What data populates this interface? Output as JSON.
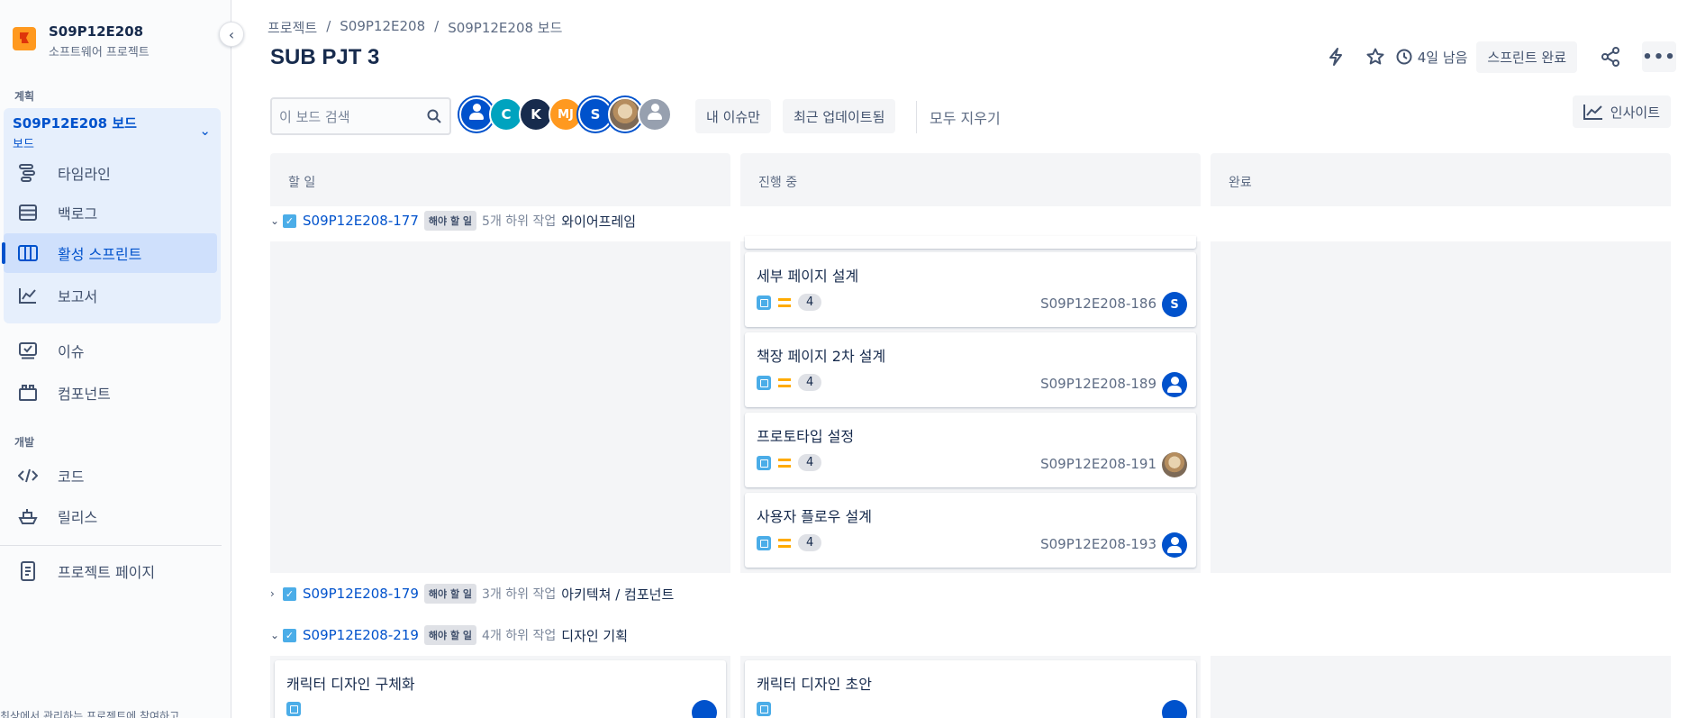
{
  "sidebar": {
    "project_name": "S09P12E208",
    "project_type": "소프트웨어 프로젝트",
    "section_plan": "계획",
    "board_name": "S09P12E208 보드",
    "board_sub": "보드",
    "items": [
      {
        "label": "타임라인",
        "icon": "timeline-icon"
      },
      {
        "label": "백로그",
        "icon": "backlog-icon"
      },
      {
        "label": "활성 스프린트",
        "icon": "board-icon"
      },
      {
        "label": "보고서",
        "icon": "reports-icon"
      }
    ],
    "items_more": [
      {
        "label": "이슈",
        "icon": "issues-icon"
      },
      {
        "label": "컴포넌트",
        "icon": "components-icon"
      }
    ],
    "section_dev": "개발",
    "dev_items": [
      {
        "label": "코드",
        "icon": "code-icon"
      },
      {
        "label": "릴리스",
        "icon": "release-icon"
      }
    ],
    "project_page": "프로젝트 페이지",
    "footer_text": "최상에서 관리하는 프로젝트에 참여하고"
  },
  "header": {
    "breadcrumb": [
      "프로젝트",
      "S09P12E208",
      "S09P12E208 보드"
    ],
    "separator": "/",
    "title": "SUB PJT 3",
    "time_left": "4일 남음",
    "complete_sprint": "스프린트 완료",
    "more": "•••"
  },
  "filters": {
    "search_placeholder": "이 보드 검색",
    "avatars": [
      {
        "initials": "",
        "color": "#0052cc",
        "selected": true,
        "kind": "placeholder"
      },
      {
        "initials": "C",
        "color": "#00a3bf",
        "selected": false,
        "kind": "initials"
      },
      {
        "initials": "K",
        "color": "#172b4d",
        "selected": false,
        "kind": "initials"
      },
      {
        "initials": "MJ",
        "color": "#ff991f",
        "selected": false,
        "kind": "initials"
      },
      {
        "initials": "S",
        "color": "#0052cc",
        "selected": true,
        "kind": "initials"
      },
      {
        "initials": "",
        "color": "#b58d5e",
        "selected": true,
        "kind": "photo"
      },
      {
        "initials": "",
        "color": "#97a0af",
        "selected": false,
        "kind": "placeholder-gray"
      }
    ],
    "only_my_issues": "내 이슈만",
    "recently_updated": "최근 업데이트됨",
    "clear_all": "모두 지우기",
    "insights": "인사이트"
  },
  "board": {
    "columns": [
      "할 일",
      "진행 중",
      "완료"
    ],
    "swimlanes": [
      {
        "key": "S09P12E208-177",
        "status": "해야 할 일",
        "subtasks": "5개 하위 작업",
        "summary": "와이어프레임",
        "expanded": true
      },
      {
        "key": "S09P12E208-179",
        "status": "해야 할 일",
        "subtasks": "3개 하위 작업",
        "summary": "아키텍쳐 / 컴포넌트",
        "expanded": false
      },
      {
        "key": "S09P12E208-219",
        "status": "해야 할 일",
        "subtasks": "4개 하위 작업",
        "summary": "디자인 기획",
        "expanded": true
      }
    ],
    "cards_lane1_inprogress": [
      {
        "title": "세부 페이지 설계",
        "points": "4",
        "key": "S09P12E208-186",
        "assignee": "S",
        "assignee_kind": "initials"
      },
      {
        "title": "책장 페이지 2차 설계",
        "points": "4",
        "key": "S09P12E208-189",
        "assignee": "",
        "assignee_kind": "placeholder"
      },
      {
        "title": "프로토타입 설정",
        "points": "4",
        "key": "S09P12E208-191",
        "assignee": "",
        "assignee_kind": "photo"
      },
      {
        "title": "사용자 플로우 설계",
        "points": "4",
        "key": "S09P12E208-193",
        "assignee": "",
        "assignee_kind": "placeholder"
      }
    ],
    "cards_lane3": [
      {
        "title": "캐릭터 디자인 구체화",
        "column": "할 일"
      },
      {
        "title": "캐릭터 디자인 초안",
        "column": "진행 중"
      }
    ]
  },
  "colors": {
    "accent": "#0052cc",
    "story": "#4bade8",
    "priority_medium": "#ffab00",
    "column_bg": "#f4f5f7"
  }
}
